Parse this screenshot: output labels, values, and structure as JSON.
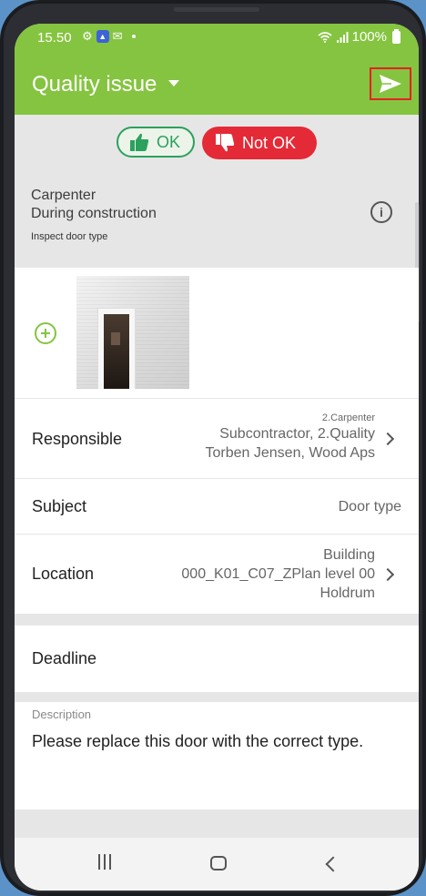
{
  "status_bar": {
    "time": "15.50",
    "battery": "100%",
    "icons": [
      "settings-icon",
      "app-notification-icon",
      "mail-icon",
      "wifi-icon",
      "signal-icon",
      "battery-icon"
    ]
  },
  "app_bar": {
    "title": "Quality issue",
    "send_icon": "send-icon",
    "accent": "#85c440"
  },
  "status_toggle": {
    "ok_label": "OK",
    "not_ok_label": "Not OK",
    "selected": "Not OK",
    "ok_color": "#2aa15d",
    "not_ok_color": "#e52a37"
  },
  "info": {
    "trade": "Carpenter",
    "phase": "During construction",
    "checkpoint": "Inspect door type"
  },
  "form": {
    "responsible": {
      "label": "Responsible",
      "group": "2.Carpenter",
      "company": "Subcontractor, 2.Quality",
      "person": "Torben Jensen, Wood Aps"
    },
    "subject": {
      "label": "Subject",
      "value": "Door type"
    },
    "location": {
      "label": "Location",
      "building": "Building",
      "plan": "000_K01_C07_ZPlan level 00",
      "area": "Holdrum"
    },
    "deadline": {
      "label": "Deadline"
    },
    "description": {
      "label": "Description",
      "value": "Please replace this door with the correct type."
    }
  }
}
